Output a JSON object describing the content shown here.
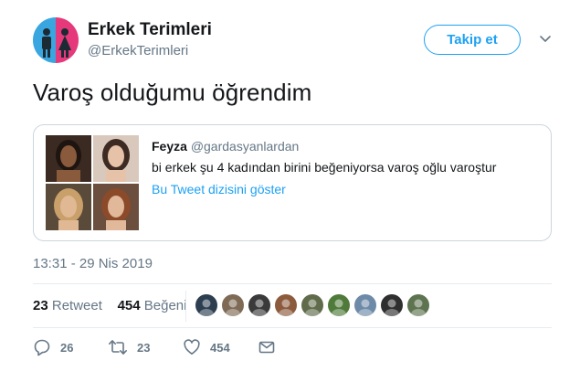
{
  "author": {
    "name": "Erkek Terimleri",
    "handle": "@ErkekTerimleri",
    "avatar_colors": [
      "#3aa6e0",
      "#e5397b"
    ]
  },
  "follow_button": {
    "label": "Takip et"
  },
  "tweet": {
    "text": "Varoş olduğumu öğrendim"
  },
  "quoted_tweet": {
    "author_name": "Feyza",
    "author_handle": "@gardasyanlardan",
    "text": "bi erkek şu 4 kadından birini beğeniyorsa varoş oğlu varoştur",
    "thread_link": "Bu Tweet dizisini göster",
    "photos": [
      {
        "icon": "woman-portrait-photo",
        "bg": "#3b2a22",
        "skin": "#8a5a3c",
        "hair": "#1e1410"
      },
      {
        "icon": "woman-portrait-photo",
        "bg": "#d9c9bd",
        "skin": "#e6c2a8",
        "hair": "#3d2a22"
      },
      {
        "icon": "woman-portrait-photo",
        "bg": "#5a4a3a",
        "skin": "#e0b894",
        "hair": "#c9a06a"
      },
      {
        "icon": "woman-portrait-photo",
        "bg": "#6b4e3d",
        "skin": "#e2b89a",
        "hair": "#8b4a2a"
      }
    ]
  },
  "timestamp": "13:31 - 29 Nis 2019",
  "stats": {
    "retweet_count": "23",
    "retweet_label": "Retweet",
    "like_count": "454",
    "like_label": "Beğeni"
  },
  "likers": [
    {
      "icon": "user-avatar",
      "color": "#2c3e50"
    },
    {
      "icon": "user-avatar",
      "color": "#7f6a55"
    },
    {
      "icon": "user-avatar",
      "color": "#3a3a3a"
    },
    {
      "icon": "user-avatar",
      "color": "#8c5a3c"
    },
    {
      "icon": "user-avatar",
      "color": "#5f6b4a"
    },
    {
      "icon": "user-avatar",
      "color": "#4f7a3a"
    },
    {
      "icon": "user-avatar",
      "color": "#6d8aa8"
    },
    {
      "icon": "user-avatar",
      "color": "#2f2f2f"
    },
    {
      "icon": "user-avatar",
      "color": "#5e7450"
    }
  ],
  "actions": {
    "reply_count": "26",
    "retweet_count": "23",
    "like_count": "454"
  },
  "colors": {
    "accent": "#1da1f2",
    "muted": "#657786",
    "border": "#ccd6dd",
    "divider": "#e6ecf0"
  }
}
